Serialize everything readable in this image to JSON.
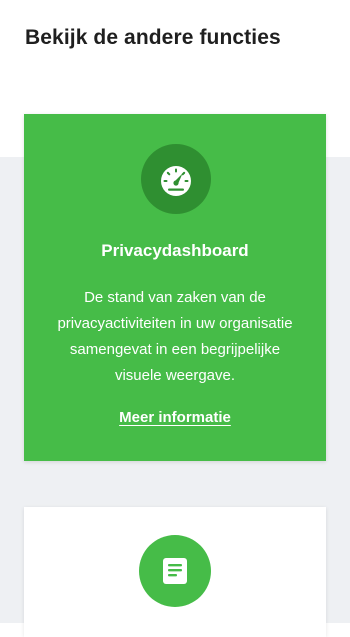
{
  "section": {
    "title": "Bekijk de andere functies"
  },
  "cards": [
    {
      "icon": "speedometer-icon",
      "title": "Privacydashboard",
      "description": "De stand van zaken van de privacyactiviteiten in uw organisatie samengevat in een begrijpelijke visuele weergave.",
      "link_label": "Meer informatie",
      "background": "#46bc48",
      "icon_background": "#2f8f31"
    },
    {
      "icon": "document-icon",
      "background": "#ffffff",
      "icon_background": "#46bc48"
    }
  ],
  "colors": {
    "accent_green": "#46bc48",
    "page_band": "#eef0f3",
    "heading_text": "#1f1f1f"
  }
}
